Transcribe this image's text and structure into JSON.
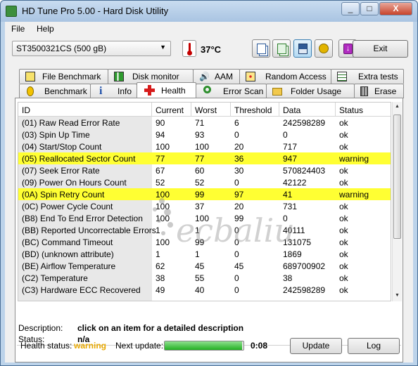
{
  "window": {
    "title": "HD Tune Pro 5.00 - Hard Disk Utility",
    "controls": [
      "_",
      "□",
      "X"
    ]
  },
  "menu": [
    {
      "label": "File"
    },
    {
      "label": "Help"
    }
  ],
  "toolbar": {
    "drive_selected": "ST3500321CS (500 gB)",
    "temperature": "37°C",
    "icons": [
      "copy-icon",
      "copy-info-icon",
      "save-icon",
      "options-icon",
      "download-icon"
    ],
    "exit_label": "Exit"
  },
  "tabs_row1": [
    {
      "label": "File Benchmark",
      "icon": "file-benchmark-icon"
    },
    {
      "label": "Disk monitor",
      "icon": "disk-monitor-icon"
    },
    {
      "label": "AAM",
      "icon": "speaker-icon"
    },
    {
      "label": "Random Access",
      "icon": "random-access-icon"
    },
    {
      "label": "Extra tests",
      "icon": "extra-tests-icon"
    }
  ],
  "tabs_row2": [
    {
      "label": "Benchmark",
      "icon": "benchmark-icon"
    },
    {
      "label": "Info",
      "icon": "info-icon"
    },
    {
      "label": "Health",
      "icon": "health-cross-icon",
      "selected": true
    },
    {
      "label": "Error Scan",
      "icon": "magnifier-icon"
    },
    {
      "label": "Folder Usage",
      "icon": "folder-icon"
    },
    {
      "label": "Erase",
      "icon": "trash-icon"
    }
  ],
  "table": {
    "columns": [
      "ID",
      "Current",
      "Worst",
      "Threshold",
      "Data",
      "Status"
    ],
    "rows": [
      {
        "id": "(01) Raw Read Error Rate",
        "current": "90",
        "worst": "71",
        "threshold": "6",
        "data": "242598289",
        "status": "ok",
        "warning": false
      },
      {
        "id": "(03) Spin Up Time",
        "current": "94",
        "worst": "93",
        "threshold": "0",
        "data": "0",
        "status": "ok",
        "warning": false
      },
      {
        "id": "(04) Start/Stop Count",
        "current": "100",
        "worst": "100",
        "threshold": "20",
        "data": "717",
        "status": "ok",
        "warning": false
      },
      {
        "id": "(05) Reallocated Sector Count",
        "current": "77",
        "worst": "77",
        "threshold": "36",
        "data": "947",
        "status": "warning",
        "warning": true
      },
      {
        "id": "(07) Seek Error Rate",
        "current": "67",
        "worst": "60",
        "threshold": "30",
        "data": "570824403",
        "status": "ok",
        "warning": false
      },
      {
        "id": "(09) Power On Hours Count",
        "current": "52",
        "worst": "52",
        "threshold": "0",
        "data": "42122",
        "status": "ok",
        "warning": false
      },
      {
        "id": "(0A) Spin Retry Count",
        "current": "100",
        "worst": "99",
        "threshold": "97",
        "data": "41",
        "status": "warning",
        "warning": true
      },
      {
        "id": "(0C) Power Cycle Count",
        "current": "100",
        "worst": "37",
        "threshold": "20",
        "data": "731",
        "status": "ok",
        "warning": false
      },
      {
        "id": "(B8) End To End Error Detection",
        "current": "100",
        "worst": "100",
        "threshold": "99",
        "data": "0",
        "status": "ok",
        "warning": false
      },
      {
        "id": "(BB) Reported Uncorrectable Errors",
        "current": "1",
        "worst": "1",
        "threshold": "0",
        "data": "40111",
        "status": "ok",
        "warning": false
      },
      {
        "id": "(BC) Command Timeout",
        "current": "100",
        "worst": "99",
        "threshold": "0",
        "data": "131075",
        "status": "ok",
        "warning": false
      },
      {
        "id": "(BD) (unknown attribute)",
        "current": "1",
        "worst": "1",
        "threshold": "0",
        "data": "1869",
        "status": "ok",
        "warning": false
      },
      {
        "id": "(BE) Airflow Temperature",
        "current": "62",
        "worst": "45",
        "threshold": "45",
        "data": "689700902",
        "status": "ok",
        "warning": false
      },
      {
        "id": "(C2) Temperature",
        "current": "38",
        "worst": "55",
        "threshold": "0",
        "data": "38",
        "status": "ok",
        "warning": false
      },
      {
        "id": "(C3) Hardware ECC Recovered",
        "current": "49",
        "worst": "40",
        "threshold": "0",
        "data": "242598289",
        "status": "ok",
        "warning": false
      }
    ]
  },
  "description": {
    "desc_label": "Description:",
    "desc_value": "click on an item for a detailed description",
    "status_label": "Status:",
    "status_value": "n/a"
  },
  "footer": {
    "health_label": "Health status:",
    "health_value": "warning",
    "next_update_label": "Next update:",
    "progress_fraction": 0.98,
    "time": "0:08",
    "update_label": "Update",
    "log_label": "Log"
  },
  "watermark_text": "ecbalium",
  "colors": {
    "warning_highlight": "#ffff33",
    "health_warning_text": "#e8a800"
  }
}
